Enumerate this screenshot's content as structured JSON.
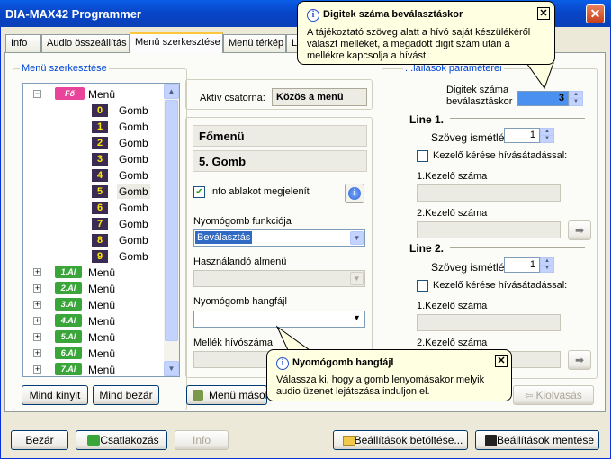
{
  "window": {
    "title": "DIA-MAX42 Programmer",
    "close": "✕"
  },
  "tabs": [
    "Info",
    "Audio összeállítás",
    "Menü szerkesztése",
    "Menü térkép",
    "L"
  ],
  "editor_group": "Menü szerkesztése",
  "params_group": "...láilasok paraméterei",
  "tree": {
    "root_badge": "Fő",
    "root_label": "Menü",
    "buttons": [
      {
        "num": "0",
        "label": "Gomb"
      },
      {
        "num": "1",
        "label": "Gomb"
      },
      {
        "num": "2",
        "label": "Gomb"
      },
      {
        "num": "3",
        "label": "Gomb"
      },
      {
        "num": "4",
        "label": "Gomb"
      },
      {
        "num": "5",
        "label": "Gomb"
      },
      {
        "num": "6",
        "label": "Gomb"
      },
      {
        "num": "7",
        "label": "Gomb"
      },
      {
        "num": "8",
        "label": "Gomb"
      },
      {
        "num": "9",
        "label": "Gomb"
      }
    ],
    "submenus": [
      {
        "badge": "1.Al",
        "label": "Menü"
      },
      {
        "badge": "2.Al",
        "label": "Menü"
      },
      {
        "badge": "3.Al",
        "label": "Menü"
      },
      {
        "badge": "4.Al",
        "label": "Menü"
      },
      {
        "badge": "5.Al",
        "label": "Menü"
      },
      {
        "badge": "6.Al",
        "label": "Menü"
      },
      {
        "badge": "7.Al",
        "label": "Menü"
      }
    ]
  },
  "tree_buttons": {
    "expand": "Mind kinyit",
    "collapse": "Mind bezár"
  },
  "middle": {
    "channel_label": "Aktív csatorna:",
    "channel_value": "Közös a menü",
    "menu_header": "Főmenü",
    "button_header": "5. Gomb",
    "info_window_label": "Info ablakot megjelenít",
    "function_label": "Nyomógomb funkciója",
    "function_value": "Beválasztás",
    "submenu_label": "Használandó almenü",
    "soundfile_label": "Nyomógomb hangfájl",
    "ext_label": "Mellék hívószáma",
    "copy_button": "Menü másolá"
  },
  "right": {
    "digits_label_1": "Digitek száma",
    "digits_label_2": "beválasztáskor",
    "digits_value": "3",
    "line1": {
      "title": "Line 1.",
      "repeat_label": "Szöveg ismétlés",
      "repeat_value": "1",
      "operator_check": "Kezelő kérése hívásátadással:",
      "op1": "1.Kezelő száma",
      "op2": "2.Kezelő száma"
    },
    "line2": {
      "title": "Line 2.",
      "repeat_label": "Szöveg ismétlés",
      "repeat_value": "1",
      "operator_check": "Kezelő kérése hívásátadással:",
      "op1": "1.Kezelő száma",
      "op2": "2.Kezelő száma"
    },
    "read_button": "Kiolvasás"
  },
  "tooltip_top": {
    "title": "Digitek száma beválasztáskor",
    "text": "A tájékoztató szöveg alatt a hívó saját készülékéről választ melléket, a megadott digit szám után a mellékre kapcsolja a hívást."
  },
  "tooltip_bottom": {
    "title": "Nyomógomb hangfájl",
    "text": "Válassza ki, hogy a gomb lenyomásakor melyik audio üzenet lejátszása induljon el."
  },
  "footer": {
    "close": "Bezár",
    "connect": "Csatlakozás",
    "info": "Info",
    "load": "Beállítások betöltése...",
    "save": "Beállítások mentése"
  },
  "colors": {
    "title_blue": "#0a5ee8",
    "root_badge": "#e8459a",
    "sub_badge": "#3aa63a",
    "num_bg": "#3b2b52",
    "num_fg": "#ffe600"
  }
}
